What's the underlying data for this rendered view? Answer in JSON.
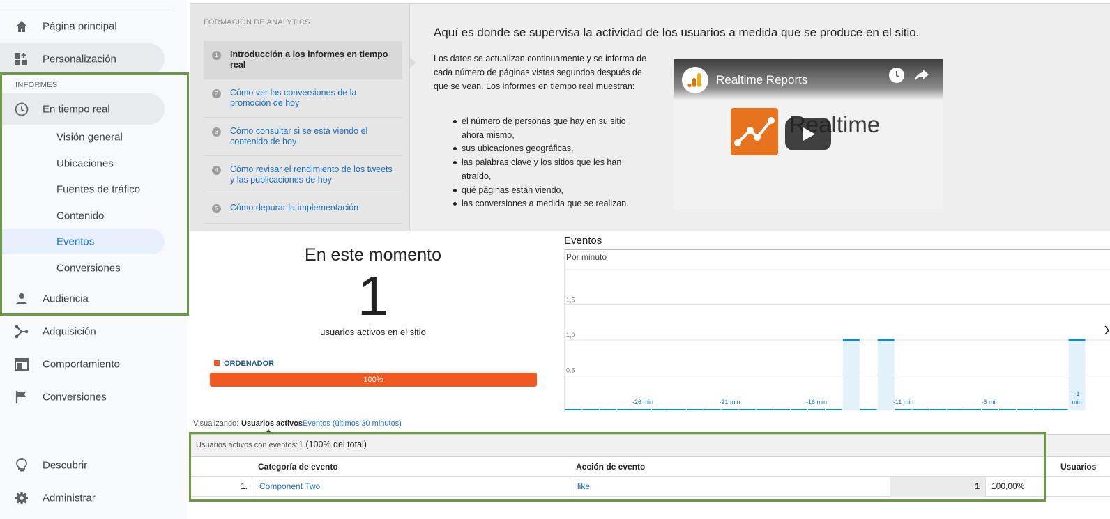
{
  "sidebar": {
    "nav_top": [
      {
        "label": "Página principal",
        "icon": "home-icon"
      },
      {
        "label": "Personalización",
        "icon": "dashboard-icon"
      }
    ],
    "section_label": "INFORMES",
    "realtime": {
      "label": "En tiempo real",
      "icon": "clock-icon"
    },
    "realtime_items": [
      {
        "label": "Visión general"
      },
      {
        "label": "Ubicaciones"
      },
      {
        "label": "Fuentes de tráfico"
      },
      {
        "label": "Contenido"
      },
      {
        "label": "Eventos",
        "selected": true
      },
      {
        "label": "Conversiones"
      }
    ],
    "nav_bottom": [
      {
        "label": "Audiencia",
        "icon": "person-icon"
      },
      {
        "label": "Adquisición",
        "icon": "acquisition-icon"
      },
      {
        "label": "Comportamiento",
        "icon": "behavior-icon"
      },
      {
        "label": "Conversiones",
        "icon": "flag-icon"
      }
    ],
    "footer": [
      {
        "label": "Descubrir",
        "icon": "lightbulb-icon"
      },
      {
        "label": "Administrar",
        "icon": "gear-icon"
      }
    ]
  },
  "training": {
    "heading": "FORMACIÓN DE ANALYTICS",
    "steps": [
      {
        "num": "1",
        "text": "Introducción a los informes en tiempo real"
      },
      {
        "num": "2",
        "text": "Cómo ver las conversiones de la promoción de hoy"
      },
      {
        "num": "3",
        "text": "Cómo consultar si se está viendo el contenido de hoy"
      },
      {
        "num": "4",
        "text": "Cómo revisar el rendimiento de los tweets y las publicaciones de hoy"
      },
      {
        "num": "5",
        "text": "Cómo depurar la implementación"
      }
    ],
    "title": "Aquí es donde se supervisa la actividad de los usuarios a medida que se produce en el sitio.",
    "body": "Los datos se actualizan continuamente y se informa de cada número de páginas vistas segundos después de que se vean. Los informes en tiempo real muestran:",
    "bullets": [
      "el número de personas que hay en su sitio ahora mismo,",
      "sus ubicaciones geográficas,",
      "las palabras clave y los sitios que les han atraído,",
      "qué páginas están viendo,",
      "las conversiones a medida que se realizan."
    ],
    "video": {
      "title": "Realtime Reports",
      "word": "Realtime"
    }
  },
  "now": {
    "title": "En este momento",
    "count": "1",
    "label": "usuarios activos en el sitio",
    "device_label": "ORDENADOR",
    "device_pct": "100%",
    "device_fraction": 1.0,
    "device_color": "#f05a22"
  },
  "chart_data": {
    "type": "bar",
    "title": "Eventos",
    "subtitle": "Por minuto",
    "y_ticks": [
      "0,5",
      "1,0",
      "1,5"
    ],
    "ylim": [
      0,
      2
    ],
    "x_tick_labels": [
      "-26 min",
      "-21 min",
      "-16 min",
      "-11 min",
      "-6 min",
      "-1 min"
    ],
    "x_tick_minutes": [
      -26,
      -21,
      -16,
      -11,
      -6,
      -1
    ],
    "minutes": [
      -30,
      -29,
      -28,
      -27,
      -26,
      -25,
      -24,
      -23,
      -22,
      -21,
      -20,
      -19,
      -18,
      -17,
      -16,
      -15,
      -14,
      -13,
      -12,
      -11,
      -10,
      -9,
      -8,
      -7,
      -6,
      -5,
      -4,
      -3,
      -2,
      -1
    ],
    "values": [
      0,
      0,
      0,
      0,
      0,
      0,
      0,
      0,
      0,
      0,
      0,
      0,
      0,
      0,
      0,
      0,
      1,
      0,
      1,
      0,
      0,
      0,
      0,
      0,
      0,
      0,
      0,
      0,
      0,
      1
    ],
    "bar_color": "#0a8ccf",
    "grid": true
  },
  "viewing": {
    "label": "Visualizando:",
    "active": "Usuarios activos",
    "link": "Eventos (últimos 30 minutos)"
  },
  "table": {
    "summary_label": "Usuarios activos con eventos:",
    "summary_value": "1 (100% del total)",
    "columns": [
      "Categoría de evento",
      "Acción de evento",
      "Usuarios"
    ],
    "rows": [
      {
        "index": "1.",
        "category": "Component Two",
        "action": "like",
        "users": "1",
        "pct": "100,00%"
      }
    ]
  }
}
